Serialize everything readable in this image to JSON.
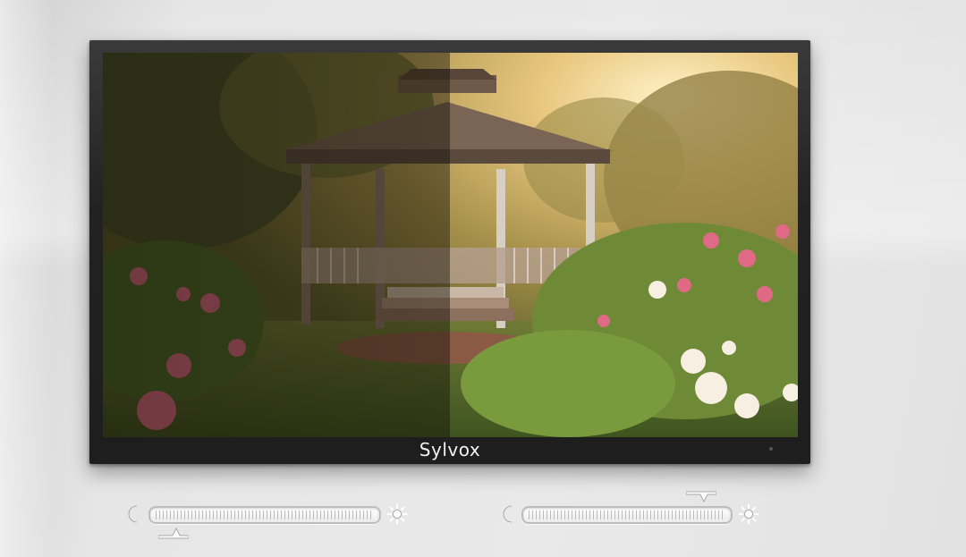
{
  "monitor": {
    "brand": "Sylvox",
    "screen_image": "garden-gazebo-photo",
    "comparison": {
      "left_half": "dimmed",
      "right_half": "bright"
    }
  },
  "sliders": [
    {
      "name": "brightness-dim",
      "left_icon": "moon-icon",
      "right_icon": "sun-icon",
      "level": 0.12,
      "thumb": "below"
    },
    {
      "name": "brightness-bright",
      "left_icon": "moon-icon",
      "right_icon": "sun-icon",
      "level": 0.88,
      "thumb": "above"
    }
  ],
  "colors": {
    "bezel": "#1f1f1f",
    "brand_text": "#f2f2f2",
    "track": "#ffffff",
    "icon": "#ffffff"
  }
}
